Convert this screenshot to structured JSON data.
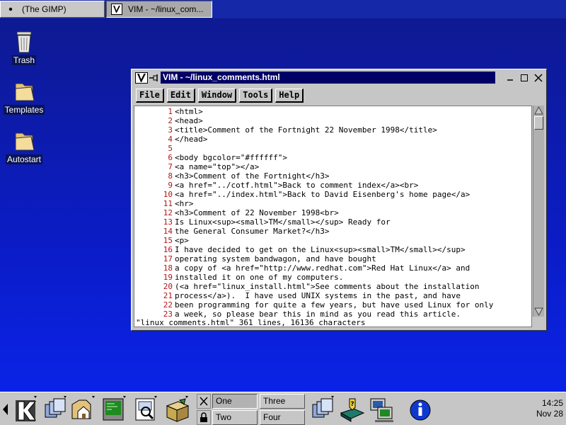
{
  "taskbar": {
    "items": [
      {
        "label": "(The GIMP)",
        "icon": "dot-icon",
        "active": false
      },
      {
        "label": "VIM - ~/linux_com...",
        "icon": "vim-icon",
        "active": true
      }
    ]
  },
  "desktop": {
    "icons": [
      {
        "label": "Trash",
        "icon": "trash-icon"
      },
      {
        "label": "Templates",
        "icon": "folder-icon"
      },
      {
        "label": "Autostart",
        "icon": "folder-icon"
      }
    ]
  },
  "vim": {
    "title": "VIM - ~/linux_comments.html",
    "menu": [
      "File",
      "Edit",
      "Window",
      "Tools",
      "Help"
    ],
    "lines": [
      {
        "n": "1",
        "text": "<html>"
      },
      {
        "n": "2",
        "text": "<head>"
      },
      {
        "n": "3",
        "text": "<title>Comment of the Fortnight 22 November 1998</title>"
      },
      {
        "n": "4",
        "text": "</head>"
      },
      {
        "n": "5",
        "text": ""
      },
      {
        "n": "6",
        "text": "<body bgcolor=\"#ffffff\">"
      },
      {
        "n": "7",
        "text": "<a name=\"top\"></a>"
      },
      {
        "n": "8",
        "text": "<h3>Comment of the Fortnight</h3>"
      },
      {
        "n": "9",
        "text": "<a href=\"../cotf.html\">Back to comment index</a><br>"
      },
      {
        "n": "10",
        "text": "<a href=\"../index.html\">Back to David Eisenberg's home page</a>"
      },
      {
        "n": "11",
        "text": "<hr>"
      },
      {
        "n": "12",
        "text": "<h3>Comment of 22 November 1998<br>"
      },
      {
        "n": "13",
        "text": "Is Linux<sup><small>TM</small></sup> Ready for"
      },
      {
        "n": "14",
        "text": "the General Consumer Market?</h3>"
      },
      {
        "n": "15",
        "text": "<p>"
      },
      {
        "n": "16",
        "text": "I have decided to get on the Linux<sup><small>TM</small></sup>"
      },
      {
        "n": "17",
        "text": "operating system bandwagon, and have bought"
      },
      {
        "n": "18",
        "text": "a copy of <a href=\"http://www.redhat.com\">Red Hat Linux</a> and"
      },
      {
        "n": "19",
        "text": "installed it on one of my computers."
      },
      {
        "n": "20",
        "text": "(<a href=\"linux_install.html\">See comments about the installation"
      },
      {
        "n": "21",
        "text": "process</a>).  I have used UNIX systems in the past, and have"
      },
      {
        "n": "22",
        "text": "been programming for quite a few years, but have used Linux for only"
      },
      {
        "n": "23",
        "text": "a week, so please bear this in mind as you read this article."
      }
    ],
    "status_line": "\"linux_comments.html\" 361 lines, 16136 characters"
  },
  "panel": {
    "launchers": [
      "k-menu-icon",
      "window-list-icon",
      "home-icon",
      "terminal-icon",
      "file-manager-icon",
      "package-icon",
      "window-list-icon",
      "help-book-icon",
      "network-icon",
      "info-icon"
    ],
    "desktops": [
      {
        "label": "One",
        "active": true
      },
      {
        "label": "Three",
        "active": false
      },
      {
        "label": "Two",
        "active": false
      },
      {
        "label": "Four",
        "active": false
      }
    ],
    "clock": {
      "time": "14:25",
      "date": "Nov 28"
    }
  },
  "colors": {
    "desktop_top": "#0e1a8e",
    "desktop_bottom": "#0a24ee",
    "title_active": "#000066",
    "line_number": "#b21616",
    "chrome": "#c6c6c6"
  }
}
